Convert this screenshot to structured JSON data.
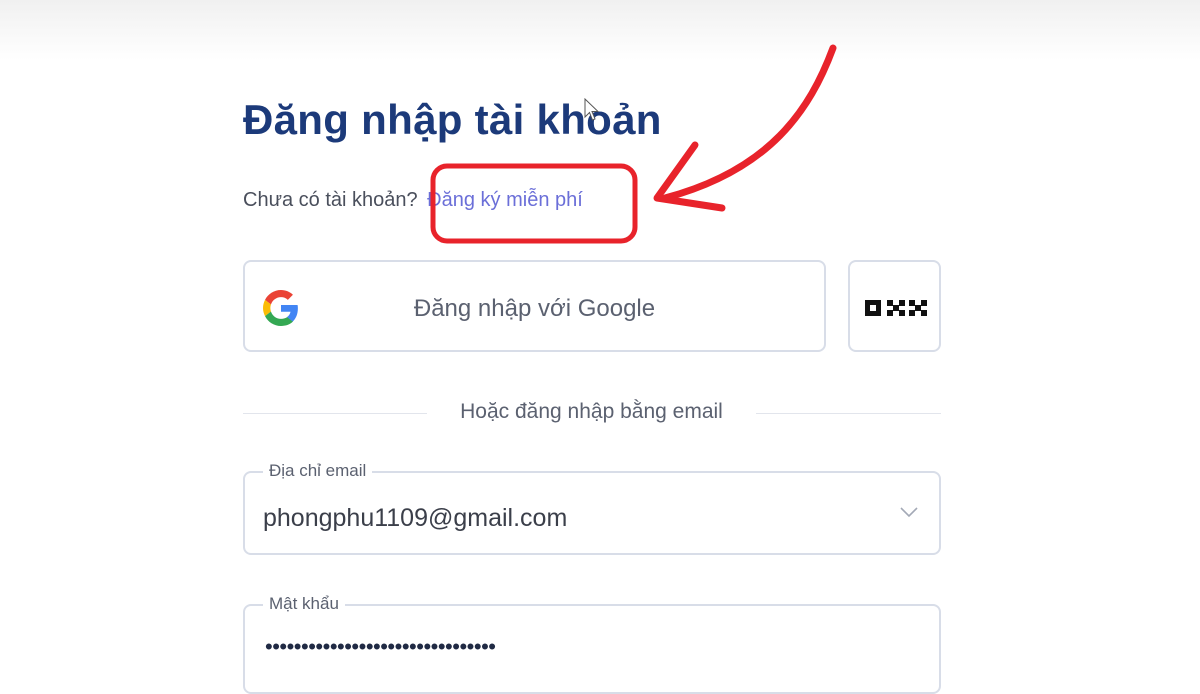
{
  "page": {
    "title": "Đăng nhập tài khoản"
  },
  "signup": {
    "prompt": "Chưa có tài khoản?",
    "link_label": "Đăng ký miễn phí"
  },
  "social": {
    "google_label": "Đăng nhập với Google",
    "google_icon": "google-icon",
    "okx_icon": "okx-icon"
  },
  "divider": {
    "text": "Hoặc đăng nhập bằng email"
  },
  "email": {
    "label": "Địa chỉ email",
    "value": "phongphu1109@gmail.com"
  },
  "password": {
    "label": "Mật khẩu",
    "value": "••••••••••••••••••••••••••••••••"
  },
  "colors": {
    "title": "#1c3a7a",
    "link": "#6b6fd8",
    "annotation": "#e8232b",
    "border": "#d8dde8"
  }
}
